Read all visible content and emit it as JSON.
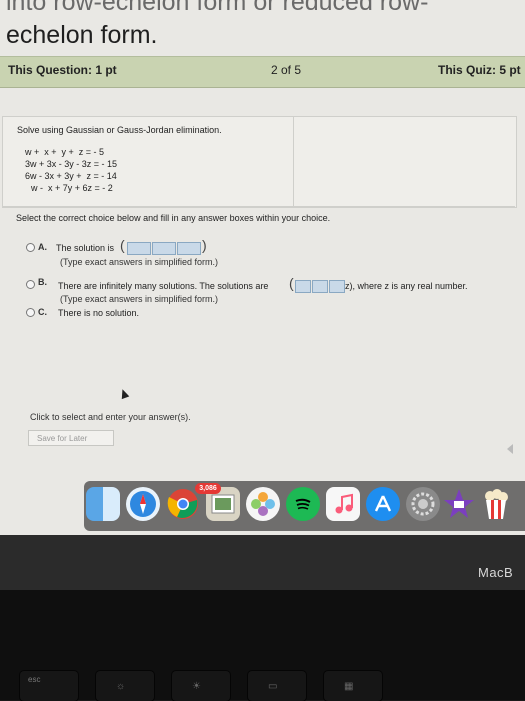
{
  "heading": {
    "line1": "into row-echelon form or reduced row-",
    "line2": "echelon form."
  },
  "question_bar": {
    "this_question": "This Question: 1 pt",
    "position": "2 of 5",
    "this_quiz": "This Quiz: 5 pt"
  },
  "problem": {
    "instruction": "Solve using Gaussian or Gauss-Jordan elimination.",
    "equations": [
      "w +  x +  y +  z = - 5",
      "3w + 3x - 3y - 3z = - 15",
      "6w - 3x + 3y +  z = - 14",
      "w -  x + 7y + 6z = - 2"
    ]
  },
  "select_prompt": "Select the correct choice below and fill in any answer boxes within your choice.",
  "choices": [
    {
      "letter": "A.",
      "text": "The solution is",
      "hint": "(Type exact answers in simplified form.)"
    },
    {
      "letter": "B.",
      "text": "There are infinitely many solutions. The solutions are",
      "suffix": "z), where z is any real number.",
      "hint": "(Type exact answers in simplified form.)"
    },
    {
      "letter": "C.",
      "text": "There is no solution."
    }
  ],
  "footer": {
    "click_prompt": "Click to select and enter your answer(s).",
    "save_label": "Save for Later"
  },
  "dock": {
    "badge": "3,086",
    "icons": [
      "finder-icon",
      "safari-icon",
      "chrome-icon",
      "preview-icon",
      "photos-icon",
      "spotify-icon",
      "music-icon",
      "app-store-icon",
      "system-preferences-icon",
      "imovie-icon",
      "popcorn-icon"
    ]
  },
  "laptop": {
    "brand": "MacB",
    "esc_key": "esc"
  }
}
